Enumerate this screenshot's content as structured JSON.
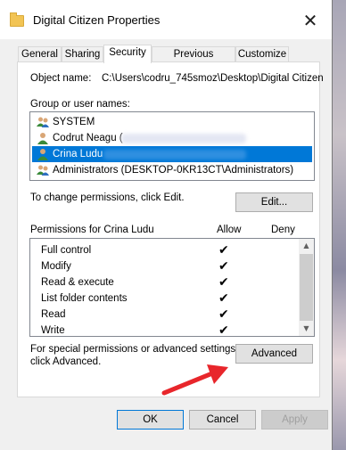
{
  "window": {
    "title": "Digital Citizen Properties",
    "close_glyph": "✕"
  },
  "tabs": [
    "General",
    "Sharing",
    "Security",
    "Previous Versions",
    "Customize"
  ],
  "active_tab": "Security",
  "object": {
    "label": "Object name:",
    "value": "C:\\Users\\codru_745smoz\\Desktop\\Digital Citizen"
  },
  "groups": {
    "label": "Group or user names:",
    "items": [
      {
        "name": "SYSTEM",
        "icon": "group-users-icon"
      },
      {
        "name": "Codrut Neagu (",
        "icon": "user-icon"
      },
      {
        "name": "Crina Ludu",
        "icon": "user-icon",
        "selected": true
      },
      {
        "name": "Administrators (DESKTOP-0KR13CT\\Administrators)",
        "icon": "group-users-icon"
      }
    ]
  },
  "change_permissions": {
    "text": "To change permissions, click Edit.",
    "button": "Edit..."
  },
  "permissions": {
    "header": "Permissions for Crina Ludu",
    "allow_label": "Allow",
    "deny_label": "Deny",
    "rows": [
      {
        "name": "Full control",
        "allow": "✔"
      },
      {
        "name": "Modify",
        "allow": "✔"
      },
      {
        "name": "Read & execute",
        "allow": "✔"
      },
      {
        "name": "List folder contents",
        "allow": "✔"
      },
      {
        "name": "Read",
        "allow": "✔"
      },
      {
        "name": "Write",
        "allow": "✔"
      }
    ]
  },
  "advanced": {
    "text_line1": "For special permissions or advanced settings,",
    "text_line2": "click Advanced.",
    "button": "Advanced"
  },
  "footer": {
    "ok": "OK",
    "cancel": "Cancel",
    "apply": "Apply"
  },
  "colors": {
    "selection": "#0078d7",
    "arrow": "#e8262b"
  }
}
